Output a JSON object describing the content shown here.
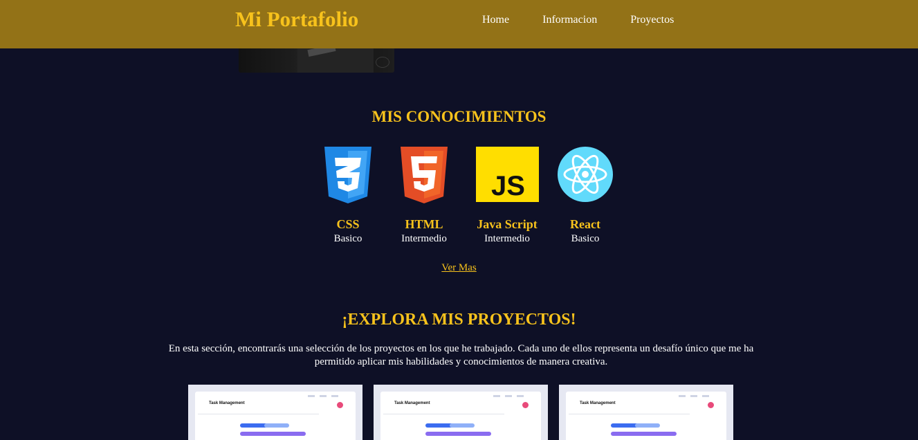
{
  "header": {
    "brand": "Mi Portafolio",
    "nav": [
      "Home",
      "Informacion",
      "Proyectos"
    ]
  },
  "skills_section": {
    "title": "MIS CONOCIMIENTOS",
    "items": [
      {
        "name": "CSS",
        "level": "Basico",
        "icon": "css3-icon",
        "color": "#2196f3"
      },
      {
        "name": "HTML",
        "level": "Intermedio",
        "icon": "html5-icon",
        "color": "#f4631e"
      },
      {
        "name": "Java Script",
        "level": "Intermedio",
        "icon": "javascript-icon",
        "color": "#ffde00"
      },
      {
        "name": "React",
        "level": "Basico",
        "icon": "react-icon",
        "color": "#61dafb"
      }
    ],
    "more_link": "Ver Mas"
  },
  "projects_section": {
    "title": "¡EXPLORA MIS PROYECTOS!",
    "intro": "En esta sección, encontrarás una selección de los proyectos en los que he trabajado. Cada uno de ellos representa un desafío único que me ha permitido aplicar mis habilidades y conocimientos de manera creativa.",
    "cards": [
      {
        "title": "Task Management"
      },
      {
        "title": "Task Management"
      },
      {
        "title": "Task Management"
      }
    ]
  },
  "colors": {
    "header_bg": "#937217",
    "page_bg": "#0e1026",
    "accent": "#f7c21c"
  }
}
